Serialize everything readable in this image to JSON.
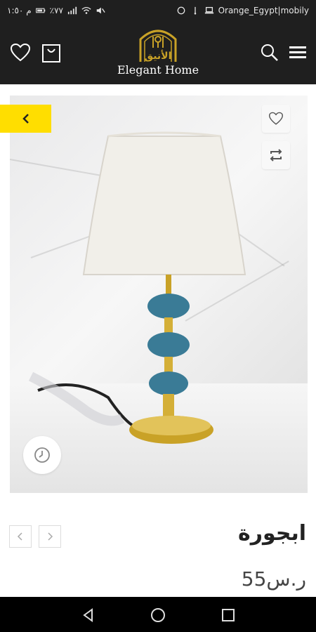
{
  "status_bar": {
    "time": "م ١:٥٠",
    "left_info": "٪٧٧",
    "carrier": "Orange_Egypt|mobily"
  },
  "header": {
    "brand_name": "Elegant Home",
    "logo_arabic": "الأنيق",
    "icons": [
      "heart-icon",
      "bag-icon",
      "search-icon",
      "menu-icon"
    ]
  },
  "product": {
    "title": "ابجورة",
    "price": "ر.س55",
    "image_alt": "lamp",
    "colors": {
      "accent": "#ffde00",
      "header_bg": "#1f1f1f",
      "gold": "#c9a227"
    }
  },
  "navigation": {
    "back_icon": "chevron-left-icon",
    "prev_icon": "chevron-left-icon",
    "next_icon": "chevron-right-icon"
  }
}
